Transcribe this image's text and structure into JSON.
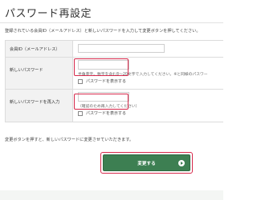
{
  "page": {
    "title": "パスワード再設定",
    "intro": "登録されている会員ID（メールアドレス）と新しいパスワードを入力して変更ボタンを押してください。"
  },
  "form": {
    "member_id_label": "会員ID（メールアドレス）",
    "member_id_value": "",
    "new_password_label": "新しいパスワード",
    "new_password_value": "",
    "new_password_hint": "半角英字、数字を含む8～20文字で入力してください。※と同様のパスワー",
    "new_password_show_label": "パスワードを表示する",
    "confirm_password_label": "新しいパスワードを再入力",
    "confirm_password_value": "",
    "confirm_password_hint": "（確認のため再入力してください）",
    "confirm_password_show_label": "パスワードを表示する"
  },
  "note": "変更ボタンを押すと、新しいパスワードに変更させていただきます。",
  "submit": {
    "label": "変更する"
  },
  "colors": {
    "accent_green": "#3d7f52",
    "highlight_red": "#d6294b"
  },
  "icons": {
    "submit_arrow": "arrow-circle-right-icon"
  }
}
